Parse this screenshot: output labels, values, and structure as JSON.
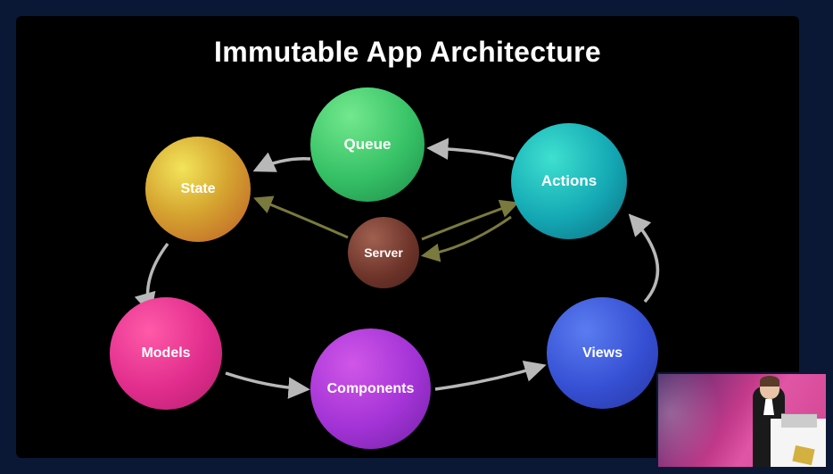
{
  "slide": {
    "title": "Immutable App Architecture",
    "nodes": {
      "state": "State",
      "queue": "Queue",
      "actions": "Actions",
      "server": "Server",
      "models": "Models",
      "components": "Components",
      "views": "Views"
    },
    "flows": {
      "light": [
        {
          "from": "queue",
          "to": "state"
        },
        {
          "from": "actions",
          "to": "queue"
        },
        {
          "from": "state",
          "to": "models"
        },
        {
          "from": "models",
          "to": "components"
        },
        {
          "from": "components",
          "to": "views"
        },
        {
          "from": "views",
          "to": "actions"
        }
      ],
      "olive": [
        {
          "from": "server",
          "to": "state"
        },
        {
          "from": "server",
          "to": "actions",
          "bidirectional": true
        }
      ]
    },
    "colors": {
      "arrow_light": "#b8b8b8",
      "arrow_olive": "#7a7a3e"
    }
  }
}
